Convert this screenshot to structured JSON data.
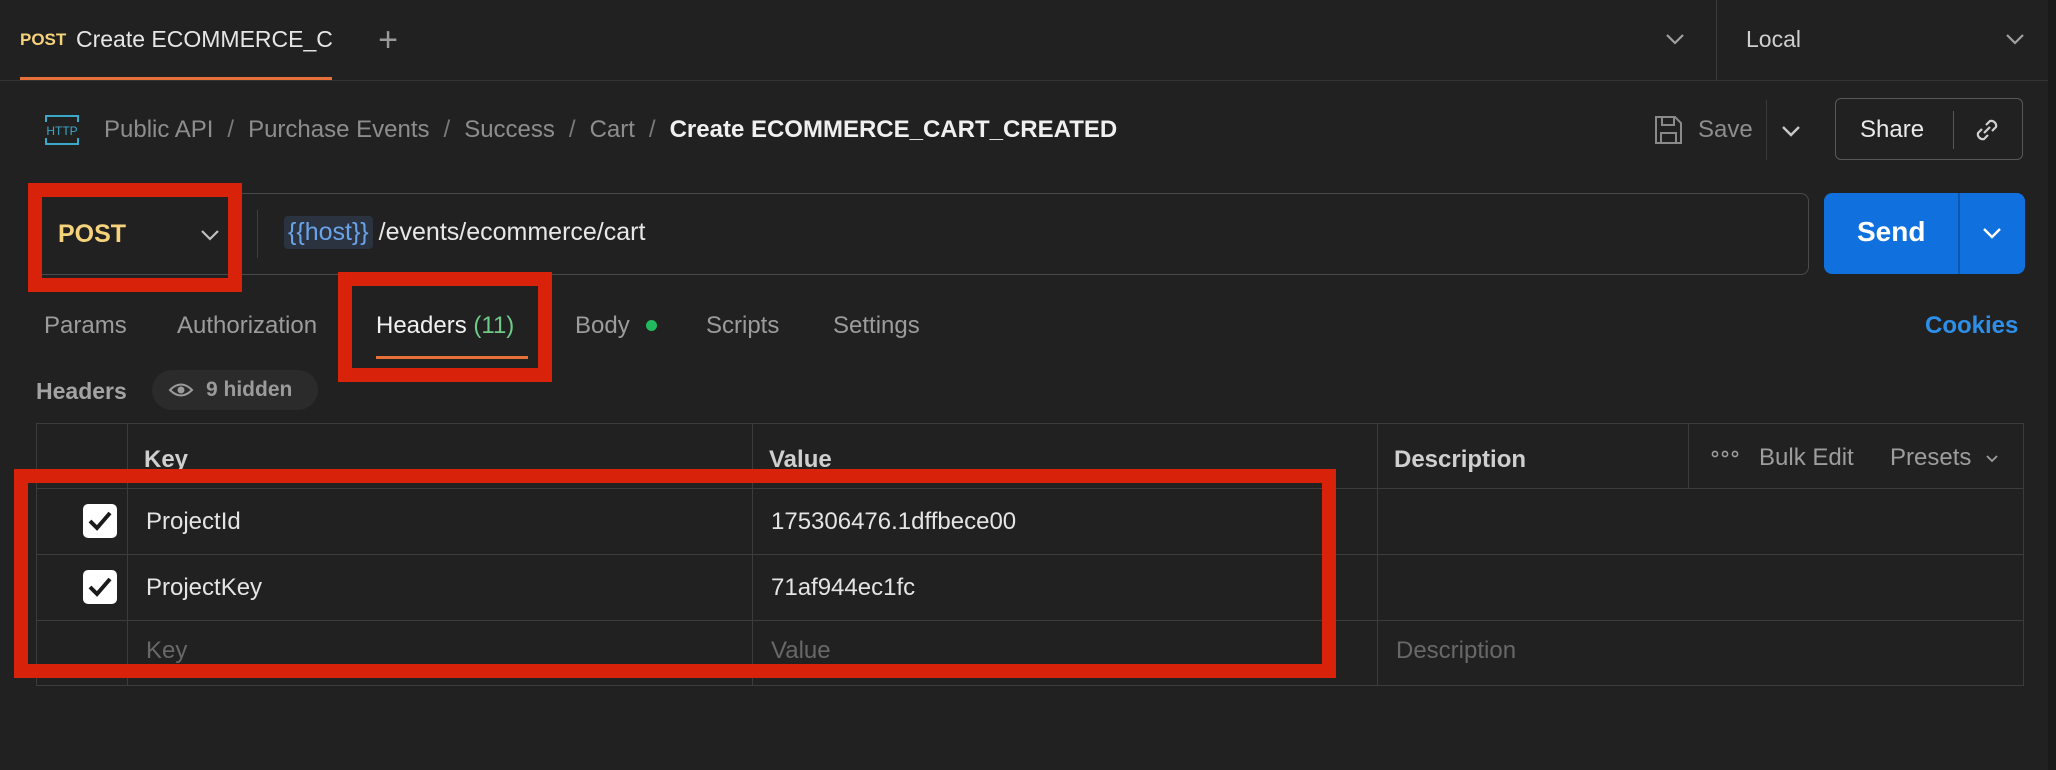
{
  "tab": {
    "method": "POST",
    "name": "Create ECOMMERCE_C"
  },
  "environment": {
    "selected": "Local"
  },
  "breadcrumb": {
    "icon": "HTTP",
    "items": [
      "Public API",
      "Purchase Events",
      "Success",
      "Cart"
    ],
    "separator": "/",
    "current": "Create ECOMMERCE_CART_CREATED"
  },
  "toolbar": {
    "save_label": "Save",
    "share_label": "Share"
  },
  "request": {
    "method": "POST",
    "url_variable": "{{host}}",
    "url_path": "/events/ecommerce/cart",
    "send_label": "Send"
  },
  "request_tabs": [
    {
      "label": "Params"
    },
    {
      "label": "Authorization"
    },
    {
      "label": "Headers",
      "count": "(11)"
    },
    {
      "label": "Body"
    },
    {
      "label": "Scripts"
    },
    {
      "label": "Settings"
    }
  ],
  "cookies_label": "Cookies",
  "headers_section": {
    "title": "Headers",
    "hidden_label": "9 hidden"
  },
  "table": {
    "columns": {
      "key": "Key",
      "value": "Value",
      "description": "Description"
    },
    "bulk_edit": "Bulk Edit",
    "presets": "Presets",
    "rows": [
      {
        "key": "ProjectId",
        "value": "175306476.1dffbece00",
        "checked": true
      },
      {
        "key": "ProjectKey",
        "value": "71af944ec1fc",
        "checked": true
      }
    ],
    "placeholder": {
      "key": "Key",
      "value": "Value",
      "description": "Description"
    }
  },
  "colors": {
    "accent": "#e8703a",
    "method_post": "#f5d37b",
    "send_button": "#1070dd",
    "highlight": "#d8220a",
    "count": "#6fca88",
    "link": "#2d8fe8"
  }
}
